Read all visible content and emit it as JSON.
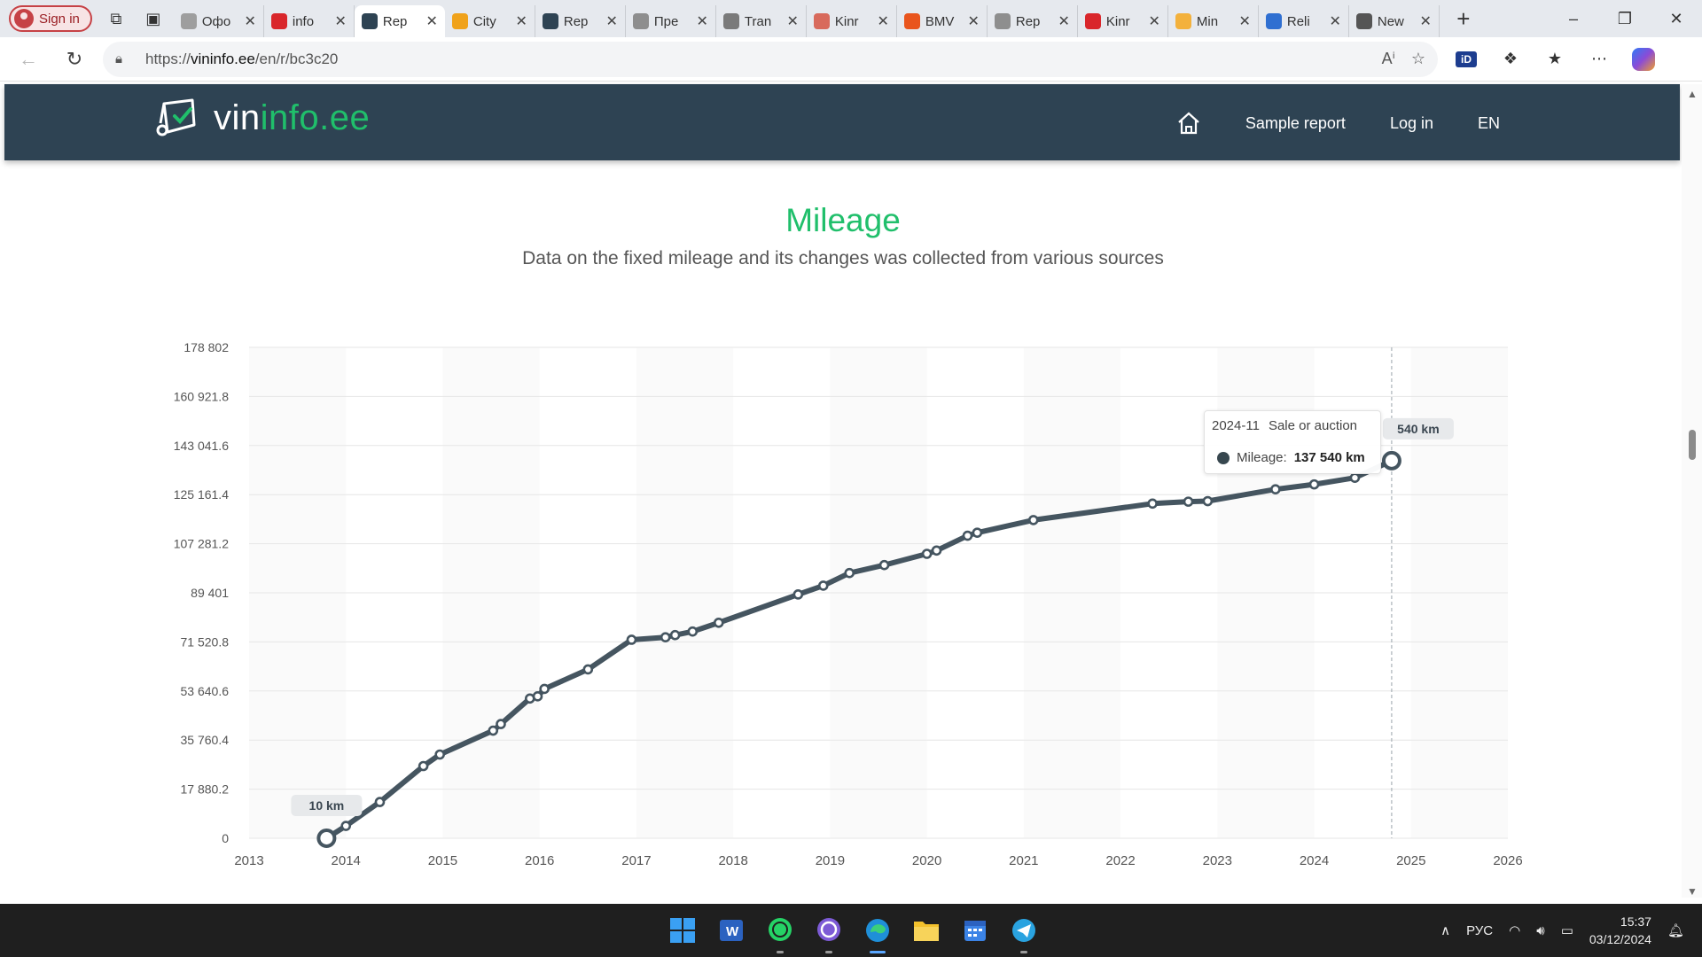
{
  "browser": {
    "signin_label": "Sign in",
    "tabs": [
      {
        "label": "Офо",
        "color": "#9e9e9e"
      },
      {
        "label": "info",
        "color": "#d9262b"
      },
      {
        "label": "Rep",
        "color": "#2e4353",
        "active": true
      },
      {
        "label": "City",
        "color": "#f0a21a"
      },
      {
        "label": "Rep",
        "color": "#2e4353"
      },
      {
        "label": "Пре",
        "color": "#8e8e8e"
      },
      {
        "label": "Tran",
        "color": "#7a7a7a"
      },
      {
        "label": "Kinr",
        "color": "#d86a5c"
      },
      {
        "label": "BMV",
        "color": "#e9551d"
      },
      {
        "label": "Rep",
        "color": "#8e8e8e"
      },
      {
        "label": "Kinr",
        "color": "#d9262b"
      },
      {
        "label": "Min",
        "color": "#f3b13c"
      },
      {
        "label": "Reli",
        "color": "#2f6fd1"
      },
      {
        "label": "New",
        "color": "#555555"
      }
    ],
    "url_prefix": "https://",
    "url_domain": "vininfo.ee",
    "url_path": "/en/r/bc3c20"
  },
  "site": {
    "logo_part1": "vin",
    "logo_part2": "info.ee",
    "menu": {
      "sample_report": "Sample report",
      "login": "Log in",
      "lang": "EN"
    }
  },
  "mileage": {
    "title": "Mileage",
    "subtitle": "Data on the fixed mileage and its changes was collected from various sources"
  },
  "tooltip": {
    "date": "2024-11",
    "event": "Sale or auction",
    "label": "Mileage:",
    "value": "137 540 km"
  },
  "chart_data": {
    "type": "line",
    "series": [
      {
        "x": [
          2013.8,
          2014.0,
          2014.35,
          2014.8,
          2014.97,
          2015.52,
          2015.6,
          2015.9,
          2015.98,
          2016.05,
          2016.5,
          2016.95,
          2017.3,
          2017.4,
          2017.58,
          2017.85,
          2018.67,
          2018.93,
          2019.2,
          2019.56,
          2020.0,
          2020.1,
          2020.42,
          2020.52,
          2021.1,
          2022.33,
          2022.7,
          2022.9,
          2023.6,
          2024.0,
          2024.42,
          2024.8
        ],
        "y": [
          10,
          4500,
          13200,
          26300,
          30500,
          39200,
          41600,
          50900,
          51700,
          54400,
          61500,
          72300,
          73200,
          74000,
          75300,
          78500,
          88800,
          92000,
          96600,
          99500,
          103600,
          104800,
          110200,
          111300,
          115900,
          121900,
          122600,
          122800,
          127100,
          128900,
          131300,
          137540
        ]
      }
    ],
    "xlim": [
      2013,
      2026
    ],
    "ylim": [
      0,
      178802
    ],
    "xticks": [
      "2013",
      "2014",
      "2015",
      "2016",
      "2017",
      "2018",
      "2019",
      "2020",
      "2021",
      "2022",
      "2023",
      "2024",
      "2025",
      "2026"
    ],
    "yticks": [
      "0",
      "17 880.2",
      "35 760.4",
      "53 640.6",
      "71 520.8",
      "89 401",
      "107 281.2",
      "125 161.4",
      "143 041.6",
      "160 921.8",
      "178 802"
    ],
    "annotations": [
      {
        "text": "10 km",
        "x": 2013.8,
        "y": 10
      },
      {
        "text": "540 km",
        "x": 2024.8,
        "y": 137540
      }
    ],
    "grid": true,
    "line_color": "#455560"
  },
  "taskbar": {
    "lang": "РУС",
    "time": "15:37",
    "date": "03/12/2024"
  }
}
